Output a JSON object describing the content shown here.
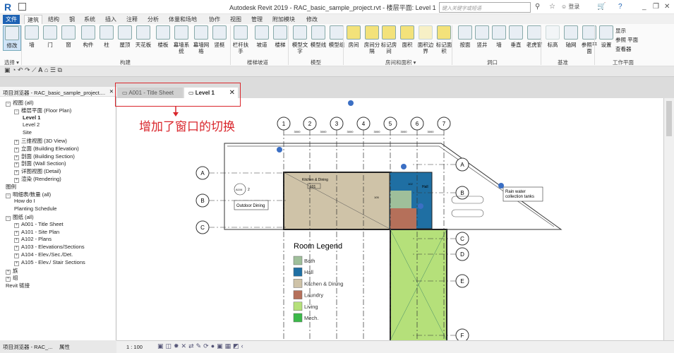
{
  "window": {
    "title": "Autodesk Revit 2019 - RAC_basic_sample_project.rvt - 楼层平面: Level 1",
    "search_placeholder": "键入关键字或短语",
    "login": "登录"
  },
  "menu": [
    "文件",
    "建筑",
    "结构",
    "钢",
    "系统",
    "插入",
    "注释",
    "分析",
    "体量和场地",
    "协作",
    "视图",
    "管理",
    "附加模块",
    "修改"
  ],
  "ribbon": {
    "buttons": [
      "修改",
      "墙",
      "门",
      "窗",
      "构件",
      "柱",
      "屋顶",
      "天花板",
      "楼板",
      "幕墙系统",
      "幕墙网格",
      "竖梃",
      "栏杆扶手",
      "坡道",
      "楼梯",
      "模型文字",
      "模型线",
      "模型组",
      "房间",
      "房间分隔",
      "标记房间",
      "面积",
      "面积边界",
      "标记面积",
      "按面",
      "竖井",
      "墙",
      "垂直",
      "老虎窗",
      "标高",
      "轴网",
      "参照平面",
      "设置"
    ],
    "small_buttons": [
      "显示",
      "参照 平面",
      "查看器"
    ],
    "panels": [
      "选择 ▾",
      "构建",
      "楼梯坡道",
      "模型",
      "房间和面积 ▾",
      "洞口",
      "基准",
      "工作平面"
    ]
  },
  "browser": {
    "title": "项目浏览器 - RAC_basic_sample_project....",
    "items": [
      {
        "label": "视图 (all)",
        "level": 0,
        "toggle": "−"
      },
      {
        "label": "楼层平面 (Floor Plan)",
        "level": 1,
        "toggle": "−"
      },
      {
        "label": "Level 1",
        "level": 2,
        "bold": true
      },
      {
        "label": "Level 2",
        "level": 2
      },
      {
        "label": "Site",
        "level": 2
      },
      {
        "label": "三维视图 (3D View)",
        "level": 1,
        "toggle": "+"
      },
      {
        "label": "立面 (Building Elevation)",
        "level": 1,
        "toggle": "+"
      },
      {
        "label": "剖面 (Building Section)",
        "level": 1,
        "toggle": "+"
      },
      {
        "label": "剖面 (Wall Section)",
        "level": 1,
        "toggle": "+"
      },
      {
        "label": "详图视图 (Detail)",
        "level": 1,
        "toggle": "+"
      },
      {
        "label": "渲染 (Rendering)",
        "level": 1,
        "toggle": "+"
      },
      {
        "label": "图例",
        "level": 0
      },
      {
        "label": "明细表/数量 (all)",
        "level": 0,
        "toggle": "−"
      },
      {
        "label": "How do I",
        "level": 1
      },
      {
        "label": "Planting Schedule",
        "level": 1
      },
      {
        "label": "图纸 (all)",
        "level": 0,
        "toggle": "−"
      },
      {
        "label": "A001 - Title Sheet",
        "level": 1,
        "toggle": "+"
      },
      {
        "label": "A101 - Site Plan",
        "level": 1,
        "toggle": "+"
      },
      {
        "label": "A102 - Plans",
        "level": 1,
        "toggle": "+"
      },
      {
        "label": "A103 - Elevations/Sections",
        "level": 1,
        "toggle": "+"
      },
      {
        "label": "A104 - Elev./Sec./Det.",
        "level": 1,
        "toggle": "+"
      },
      {
        "label": "A105 - Elev./ Stair Sections",
        "level": 1,
        "toggle": "+"
      },
      {
        "label": "族",
        "level": 0,
        "toggle": "+"
      },
      {
        "label": "组",
        "level": 0,
        "toggle": "+"
      },
      {
        "label": "Revit 链接",
        "level": 0
      }
    ],
    "bottom_tabs": [
      "项目浏览器 - RAC_...",
      "属性"
    ]
  },
  "view_tabs": [
    {
      "label": "A001 - Title Sheet",
      "active": false
    },
    {
      "label": "Level 1",
      "active": true
    }
  ],
  "annotation": "增加了窗口的切换",
  "drawing": {
    "grid_columns": [
      "1",
      "2",
      "3",
      "4",
      "5",
      "6",
      "7"
    ],
    "grid_rows": [
      "A",
      "B",
      "C",
      "D",
      "E",
      "F"
    ],
    "dimension": "3000",
    "room_tag": "Kitchen & Dining",
    "room_number": "101",
    "room_hall": "Hall",
    "room_numbers": [
      "102",
      "105"
    ],
    "outdoor": "Outdoor Dining",
    "callout": "Rain water collection tanks",
    "section_tag": "A104",
    "section_num": "2",
    "legend_title": "Room Legend",
    "legend": [
      {
        "label": "Bath",
        "color": "#9fbf9a"
      },
      {
        "label": "Hall",
        "color": "#1f6fa3"
      },
      {
        "label": "Kitchen & Dining",
        "color": "#cfc3a8"
      },
      {
        "label": "Laundry",
        "color": "#b5705a"
      },
      {
        "label": "Living",
        "color": "#b5e07a"
      },
      {
        "label": "Mech.",
        "color": "#3cb94a"
      }
    ]
  },
  "status": {
    "scale": "1 : 100"
  }
}
